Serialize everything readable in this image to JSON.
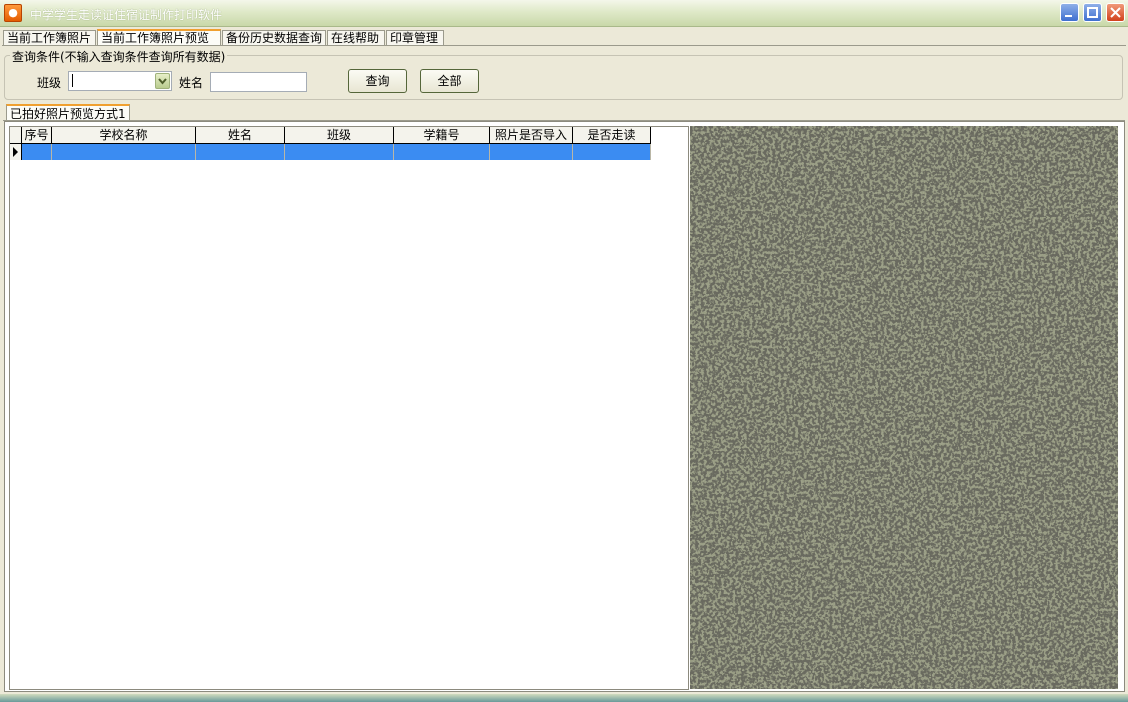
{
  "window": {
    "title": "中学学生走读证住宿证制作打印软件",
    "icon": "app-icon",
    "controls": [
      "minimize-icon",
      "maximize-icon",
      "close-icon"
    ]
  },
  "tabs": [
    {
      "label": "当前工作簿照片",
      "active": false
    },
    {
      "label": "当前工作簿照片预览",
      "active": true
    },
    {
      "label": "备份历史数据查询",
      "active": false
    },
    {
      "label": "在线帮助",
      "active": false
    },
    {
      "label": "印章管理",
      "active": false
    }
  ],
  "query": {
    "group_title": "查询条件(不输入查询条件查询所有数据)",
    "class_label": "班级",
    "class_value": "",
    "name_label": "姓名",
    "name_value": "",
    "search_button": "查询",
    "all_button": "全部"
  },
  "subtab": {
    "label": "已拍好照片预览方式1"
  },
  "table": {
    "columns": [
      "序号",
      "学校名称",
      "姓名",
      "班级",
      "学籍号",
      "照片是否导入",
      "是否走读"
    ],
    "rows": [
      [
        "",
        "",
        "",
        "",
        "",
        "",
        ""
      ]
    ],
    "selected_row": 0,
    "selection_color": "#3b8cf2"
  },
  "photo_panel": {
    "texture": "stone-speckle",
    "base_color": "#8f9379"
  },
  "colors": {
    "window_bg": "#ece9d8",
    "title_bar": "#c9d8a9",
    "tab_accent": "#f0a030"
  }
}
